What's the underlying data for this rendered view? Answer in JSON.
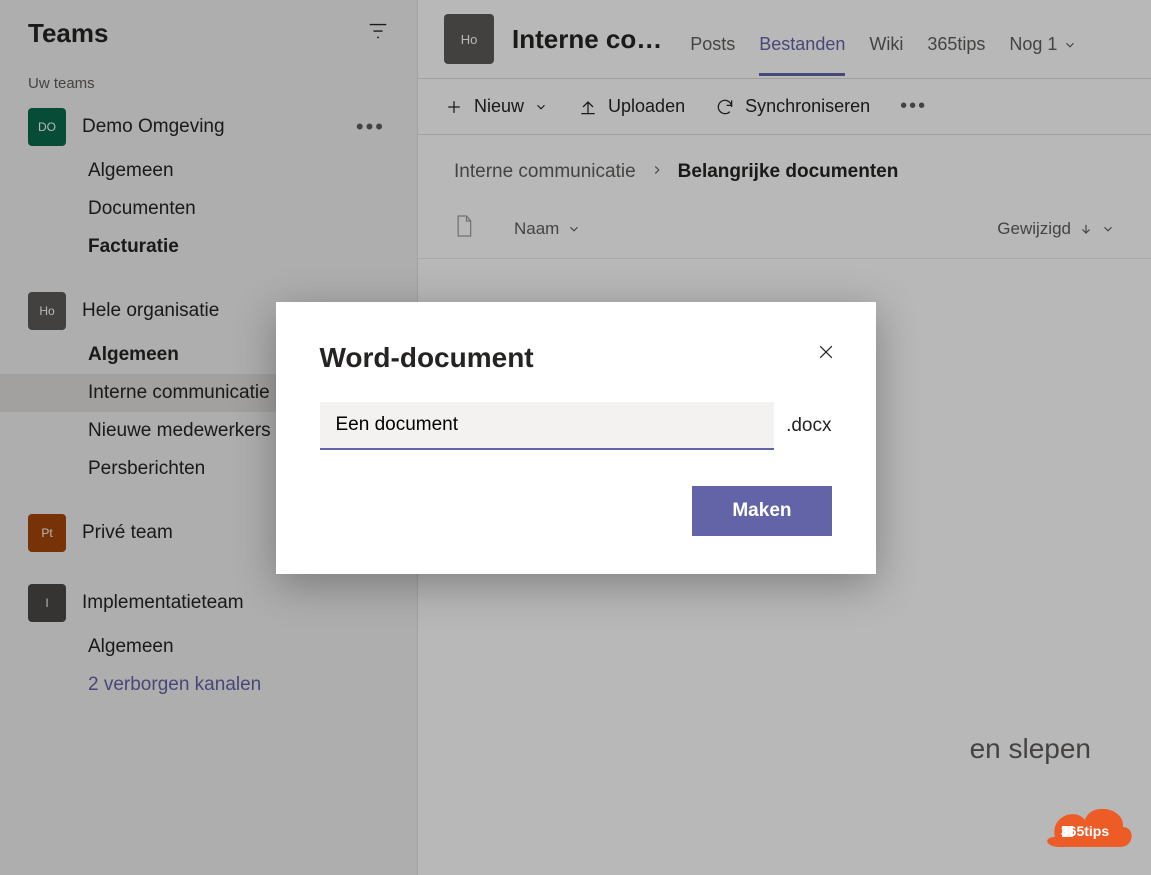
{
  "sidebar": {
    "title": "Teams",
    "section_label": "Uw teams",
    "teams": [
      {
        "avatar": "DO",
        "name": "Demo Omgeving",
        "avatar_class": "av-green",
        "channels": [
          {
            "label": "Algemeen",
            "bold": false
          },
          {
            "label": "Documenten",
            "bold": false
          },
          {
            "label": "Facturatie",
            "bold": true
          }
        ]
      },
      {
        "avatar": "Ho",
        "name": "Hele organisatie",
        "avatar_class": "av-gray",
        "channels": [
          {
            "label": "Algemeen",
            "bold": true
          },
          {
            "label": "Interne communicatie",
            "bold": false,
            "selected": true
          },
          {
            "label": "Nieuwe medewerkers",
            "bold": false
          },
          {
            "label": "Persberichten",
            "bold": false
          }
        ]
      },
      {
        "avatar": "Pt",
        "name": "Privé team",
        "avatar_class": "av-brown",
        "channels": []
      },
      {
        "avatar": "I",
        "name": "Implementatieteam",
        "avatar_class": "av-darkgray",
        "channels": [
          {
            "label": "Algemeen",
            "bold": false
          },
          {
            "label": "2 verborgen kanalen",
            "bold": false,
            "link": true
          }
        ]
      }
    ]
  },
  "header": {
    "avatar": "Ho",
    "title": "Interne co…",
    "tabs": [
      {
        "label": "Posts"
      },
      {
        "label": "Bestanden",
        "active": true
      },
      {
        "label": "Wiki"
      },
      {
        "label": "365tips"
      }
    ],
    "more_label": "Nog 1"
  },
  "toolbar": {
    "new_label": "Nieuw",
    "upload_label": "Uploaden",
    "sync_label": "Synchroniseren"
  },
  "breadcrumb": {
    "root": "Interne communicatie",
    "current": "Belangrijke documenten"
  },
  "list": {
    "name_col": "Naam",
    "modified_col": "Gewijzigd"
  },
  "empty_hint": "en slepen",
  "dialog": {
    "title": "Word-document",
    "input_value": "Een document",
    "extension": ".docx",
    "create_label": "Maken"
  },
  "badge": {
    "text": "365tips"
  }
}
